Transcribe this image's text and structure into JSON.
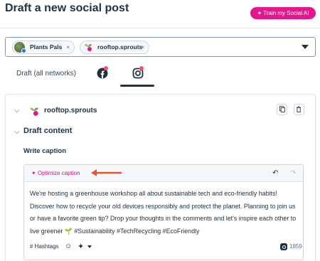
{
  "header": {
    "title": "Draft a new social post",
    "train_button": "Train my Social AI"
  },
  "account_selector": {
    "chips": [
      {
        "label": "Plants Pals",
        "remove": "×"
      },
      {
        "label": "rooftop.sprouts",
        "remove": "×"
      }
    ]
  },
  "tabs": {
    "draft_all": "Draft (all networks)",
    "facebook": "facebook-icon",
    "instagram": "instagram-icon",
    "active": "instagram"
  },
  "card": {
    "account_name": "rooftop.sprouts",
    "section_title": "Draft content",
    "caption_label": "Write caption",
    "optimize_label": "Optimize caption",
    "caption_text": "We're hosting a greenhouse workshop all about sustainable tech and eco-friendly habits! Discover how to recycle your old devices responsibly and protect the planet. Planning to join us or have a favorite green tip? Drop your thoughts in the comments and let's inspire each other to live greener 🌱 #Sustainability #TechRecycling #EcoFriendly",
    "hashtags_label": "# Hashtags",
    "char_count": "1859"
  },
  "colors": {
    "accent": "#e3178b",
    "arrow": "#e8562a",
    "text": "#213343"
  }
}
